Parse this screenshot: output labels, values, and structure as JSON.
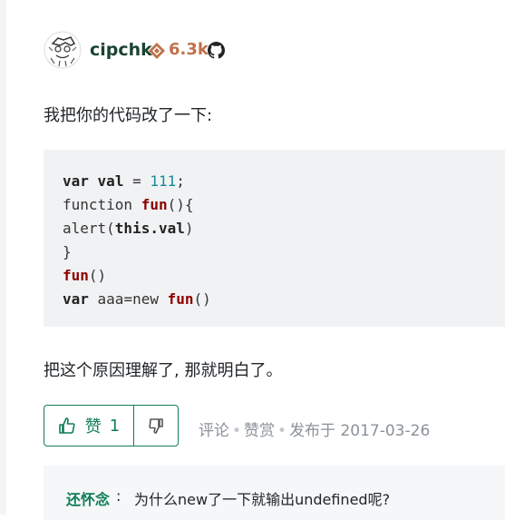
{
  "answer": {
    "author": {
      "name": "cipchk",
      "reputation": "6.3k",
      "avatar_icon": "avatar-sketch-icon",
      "reputation_icon": "reputation-diamond-icon",
      "github_icon": "github-icon"
    },
    "intro": "我把你的代码改了一下:",
    "code_lines": [
      [
        {
          "t": "var",
          "c": "kw"
        },
        {
          "t": " "
        },
        {
          "t": "val",
          "c": "kw"
        },
        {
          "t": " = "
        },
        {
          "t": "111",
          "c": "num"
        },
        {
          "t": ";"
        }
      ],
      [
        {
          "t": "function "
        },
        {
          "t": "fun",
          "c": "fn"
        },
        {
          "t": "(){"
        }
      ],
      [
        {
          "t": "alert("
        },
        {
          "t": "this.val",
          "c": "kw"
        },
        {
          "t": ")"
        }
      ],
      [
        {
          "t": "}"
        }
      ],
      [
        {
          "t": "fun",
          "c": "fn"
        },
        {
          "t": "()"
        }
      ],
      [
        {
          "t": "var",
          "c": "kw"
        },
        {
          "t": " aaa=new "
        },
        {
          "t": "fun",
          "c": "fn"
        },
        {
          "t": "()"
        }
      ]
    ],
    "conclusion": "把这个原因理解了, 那就明白了。",
    "vote": {
      "up_label": "赞",
      "up_count": "1"
    },
    "meta": {
      "comment_label": "评论",
      "reward_label": "赞赏",
      "published": "发布于 2017-03-26"
    }
  },
  "comment": {
    "author": "还怀念",
    "separator": ":",
    "text": "为什么new了一下就输出undefined呢?"
  },
  "colors": {
    "accent": "#0f7e57",
    "username": "#1b4332",
    "reputation": "#c0714a"
  }
}
